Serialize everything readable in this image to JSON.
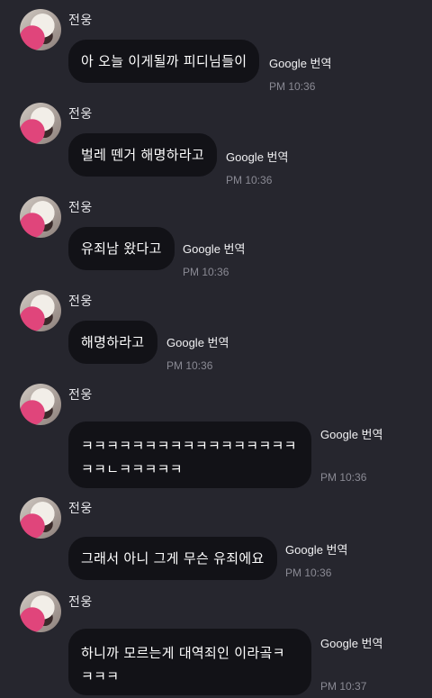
{
  "messages": [
    {
      "sender": "전웅",
      "text_lines": [
        "아 오늘 이게될까 피디님들이"
      ],
      "translate": "Google 번역",
      "time": "PM 10:36"
    },
    {
      "sender": "전웅",
      "text_lines": [
        "벌레 뗀거 해명하라고"
      ],
      "translate": "Google 번역",
      "time": "PM 10:36"
    },
    {
      "sender": "전웅",
      "text_lines": [
        "유죄남 왔다고"
      ],
      "translate": "Google 번역",
      "time": "PM 10:36"
    },
    {
      "sender": "전웅",
      "text_lines": [
        "해명하라고"
      ],
      "translate": "Google 번역",
      "time": "PM 10:36"
    },
    {
      "sender": "전웅",
      "text_lines": [
        "ㅋㅋㅋㅋㅋㅋㅋㅋㅋㅋㅋㅋㅋㅋㅋㅋㅋ",
        "ㅋㅋㄴㅋㅋㅋㅋㅋ"
      ],
      "translate": "Google 번역",
      "time": "PM 10:36"
    },
    {
      "sender": "전웅",
      "text_lines": [
        "그래서 아니 그게 무슨 유죄에요"
      ],
      "translate": "Google 번역",
      "time": "PM 10:36"
    },
    {
      "sender": "전웅",
      "text_lines": [
        "하니까 모르는게 대역죄인 이라곸ㅋ",
        "ㅋㅋㅋ"
      ],
      "translate": "Google 번역",
      "time": "PM 10:37"
    }
  ]
}
